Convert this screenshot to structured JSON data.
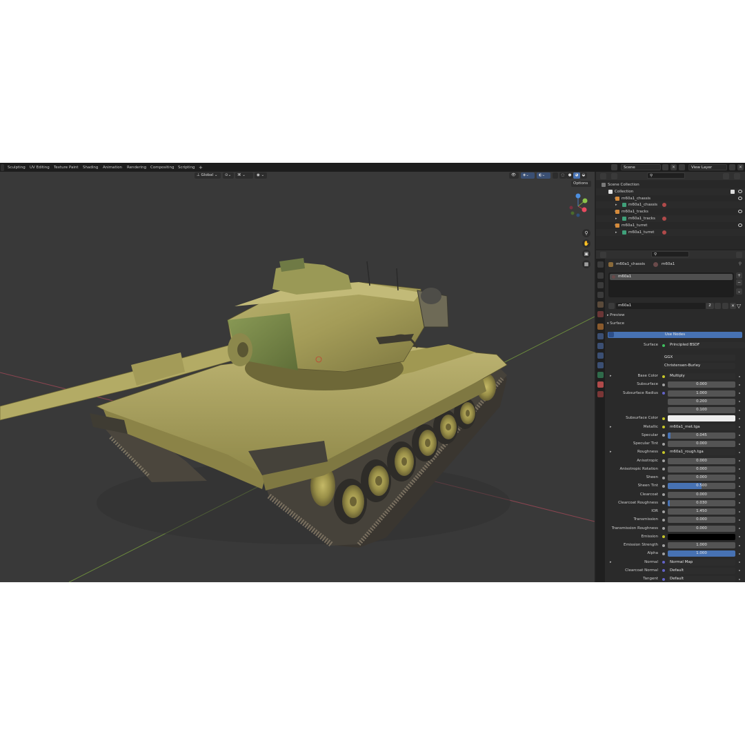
{
  "workspace_tabs": [
    "Sculpting",
    "UV Editing",
    "Texture Paint",
    "Shading",
    "Animation",
    "Rendering",
    "Compositing",
    "Scripting",
    "+"
  ],
  "topbar": {
    "scene": "Scene",
    "view_layer": "View Layer"
  },
  "viewport": {
    "orientation": "Global",
    "options": "Options",
    "gizmo_axes": [
      "X",
      "Y",
      "Z"
    ]
  },
  "outliner": {
    "search_placeholder": "",
    "rows": [
      {
        "label": "Scene Collection",
        "indent": 0
      },
      {
        "label": "Collection",
        "indent": 1
      },
      {
        "label": "m60a1_chassis",
        "indent": 2
      },
      {
        "label": "m60a1_chassis",
        "indent": 3
      },
      {
        "label": "m60a1_tracks",
        "indent": 2
      },
      {
        "label": "m60a1_tracks",
        "indent": 3
      },
      {
        "label": "m60a1_turret",
        "indent": 2
      },
      {
        "label": "m60a1_turret",
        "indent": 3
      }
    ]
  },
  "properties": {
    "object_name": "m60a1_chassis",
    "material_name": "m60a1",
    "slot": "m60a1",
    "material_field": "m60a1",
    "user_count": "2",
    "panels": {
      "preview": "Preview",
      "surface": "Surface"
    },
    "use_nodes": "Use Nodes",
    "surface_label": "Surface",
    "surface_value": "Principled BSDF",
    "distribution": "GGX",
    "subsurface_method": "Christensen-Burley",
    "rows": [
      {
        "label": "Base Color",
        "value": "Multiply",
        "kind": "link"
      },
      {
        "label": "Subsurface",
        "value": "0.000",
        "kind": "num",
        "fill": 0
      },
      {
        "label": "Subsurface Radius",
        "value": "1.000",
        "kind": "num",
        "fill": 0
      },
      {
        "label": "",
        "value": "0.200",
        "kind": "num",
        "fill": 0
      },
      {
        "label": "",
        "value": "0.100",
        "kind": "num",
        "fill": 0
      },
      {
        "label": "Subsurface Color",
        "value": "",
        "kind": "color"
      },
      {
        "label": "Metallic",
        "value": "m60a1_met.tga",
        "kind": "link"
      },
      {
        "label": "Specular",
        "value": "0.045",
        "kind": "num",
        "fill": 0.045
      },
      {
        "label": "Specular Tint",
        "value": "0.000",
        "kind": "num",
        "fill": 0
      },
      {
        "label": "Roughness",
        "value": "m60a1_rough.tga",
        "kind": "link"
      },
      {
        "label": "Anisotropic",
        "value": "0.000",
        "kind": "num",
        "fill": 0
      },
      {
        "label": "Anisotropic Rotation",
        "value": "0.000",
        "kind": "num",
        "fill": 0
      },
      {
        "label": "Sheen",
        "value": "0.000",
        "kind": "num",
        "fill": 0
      },
      {
        "label": "Sheen Tint",
        "value": "0.500",
        "kind": "num",
        "fill": 0.5
      },
      {
        "label": "Clearcoat",
        "value": "0.000",
        "kind": "num",
        "fill": 0
      },
      {
        "label": "Clearcoat Roughness",
        "value": "0.030",
        "kind": "num",
        "fill": 0.03
      },
      {
        "label": "IOR",
        "value": "1.450",
        "kind": "num",
        "fill": 0
      },
      {
        "label": "Transmission",
        "value": "0.000",
        "kind": "num",
        "fill": 0
      },
      {
        "label": "Transmission Roughness",
        "value": "0.000",
        "kind": "num",
        "fill": 0
      },
      {
        "label": "Emission",
        "value": "",
        "kind": "black"
      },
      {
        "label": "Emission Strength",
        "value": "1.000",
        "kind": "num",
        "fill": 0
      },
      {
        "label": "Alpha",
        "value": "1.000",
        "kind": "num",
        "fill": 1
      },
      {
        "label": "Normal",
        "value": "Normal Map",
        "kind": "link"
      },
      {
        "label": "Clearcoat Normal",
        "value": "Default",
        "kind": "link"
      },
      {
        "label": "Tangent",
        "value": "Default",
        "kind": "link"
      }
    ]
  },
  "colors": {
    "accent": "#4772b3",
    "tank_olive": "#a8a05c",
    "bg_viewport": "#393939"
  }
}
